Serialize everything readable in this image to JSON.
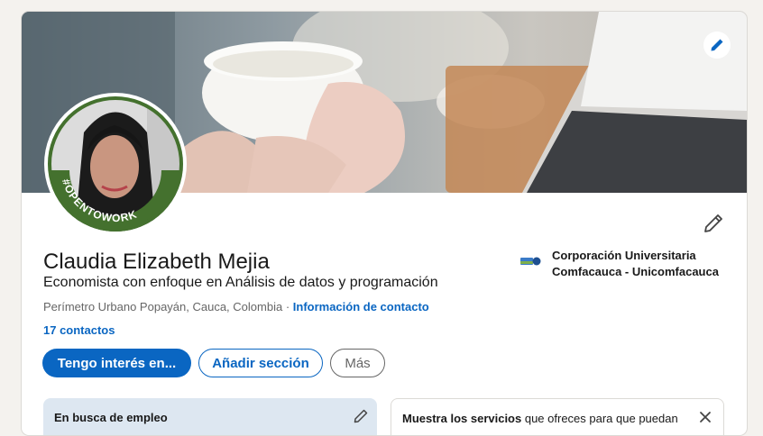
{
  "profile": {
    "name": "Claudia Elizabeth Mejia",
    "headline": "Economista con enfoque en Análisis de datos y programación",
    "location": "Perímetro Urbano Popayán, Cauca, Colombia",
    "separator": " · ",
    "contact_info_link": "Información de contacto",
    "connections": "17 contactos",
    "open_to_work_badge": "#OPENTOWORK"
  },
  "education": {
    "name": "Corporación Universitaria Comfacauca - Unicomfacauca"
  },
  "actions": {
    "primary": "Tengo interés en...",
    "add_section": "Añadir sección",
    "more": "Más"
  },
  "open_to_work_card": {
    "title": "En busca de empleo"
  },
  "services_card": {
    "text_strong": "Muestra los servicios",
    "text_rest": " que ofreces para que puedan"
  },
  "icons": {
    "banner_edit": "pencil-icon",
    "profile_edit": "pencil-icon",
    "open_card_edit": "pencil-icon",
    "services_close": "close-icon"
  },
  "colors": {
    "brand_blue": "#0a66c2",
    "open_to_work_green": "#44712e",
    "open_card_bg": "#dde7f1"
  }
}
